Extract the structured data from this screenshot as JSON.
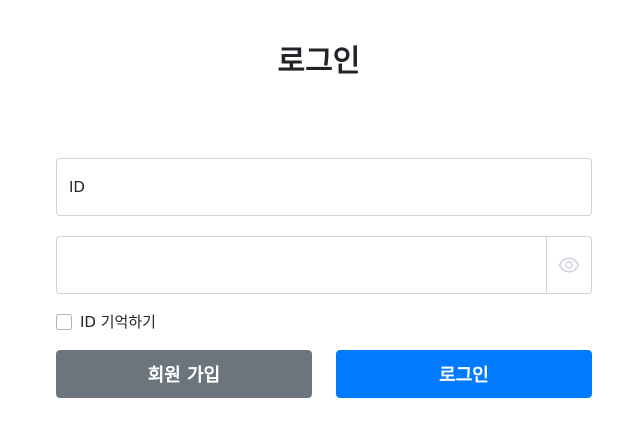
{
  "page": {
    "title": "로그인"
  },
  "form": {
    "id_placeholder": "ID",
    "id_value": "",
    "password_placeholder": "",
    "password_value": "",
    "password_toggle_icon": "eye-icon",
    "remember_label": "ID 기억하기",
    "remember_checked": false
  },
  "buttons": {
    "signup_label": "회원 가입",
    "login_label": "로그인"
  },
  "colors": {
    "signup_bg": "#6c757d",
    "login_bg": "#007bff",
    "border": "#ced4da"
  }
}
